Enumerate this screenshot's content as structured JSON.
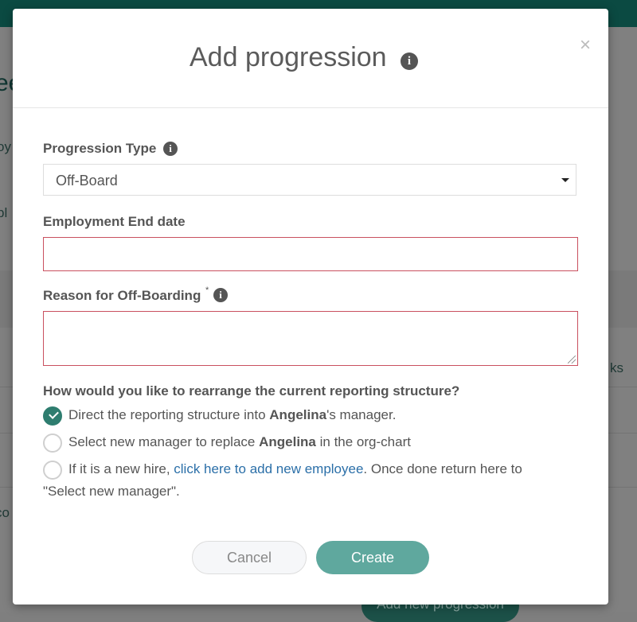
{
  "background": {
    "title_fragment": "ee",
    "fragment_1": "oy",
    "fragment_2": "pl",
    "fragment_3": "ks",
    "fragment_4": "co",
    "add_progression_button": "Add new progression"
  },
  "modal": {
    "title": "Add progression",
    "close_symbol": "×",
    "info_symbol": "i",
    "progression_type": {
      "label": "Progression Type",
      "selected": "Off-Board"
    },
    "end_date": {
      "label": "Employment End date",
      "value": ""
    },
    "reason": {
      "label": "Reason for Off-Boarding",
      "required_marker": "*",
      "value": ""
    },
    "reporting": {
      "question": "How would you like to rearrange the current reporting structure?",
      "employee_name": "Angelina",
      "option_1_prefix": "Direct the reporting structure into ",
      "option_1_suffix": "'s manager.",
      "option_2_prefix": "Select new manager to replace ",
      "option_2_suffix": " in the org-chart",
      "option_3_prefix": "If it is a new hire, ",
      "option_3_link": "click here to add new employee",
      "option_3_suffix": ". Once done return here to",
      "option_3_line2": "\"Select new manager\".",
      "selected_option": 1
    },
    "buttons": {
      "cancel": "Cancel",
      "create": "Create"
    }
  },
  "colors": {
    "accent": "#2e7d6f",
    "create_button": "#5fa89e",
    "error_border": "#c9505f",
    "link": "#2b6fa8"
  }
}
